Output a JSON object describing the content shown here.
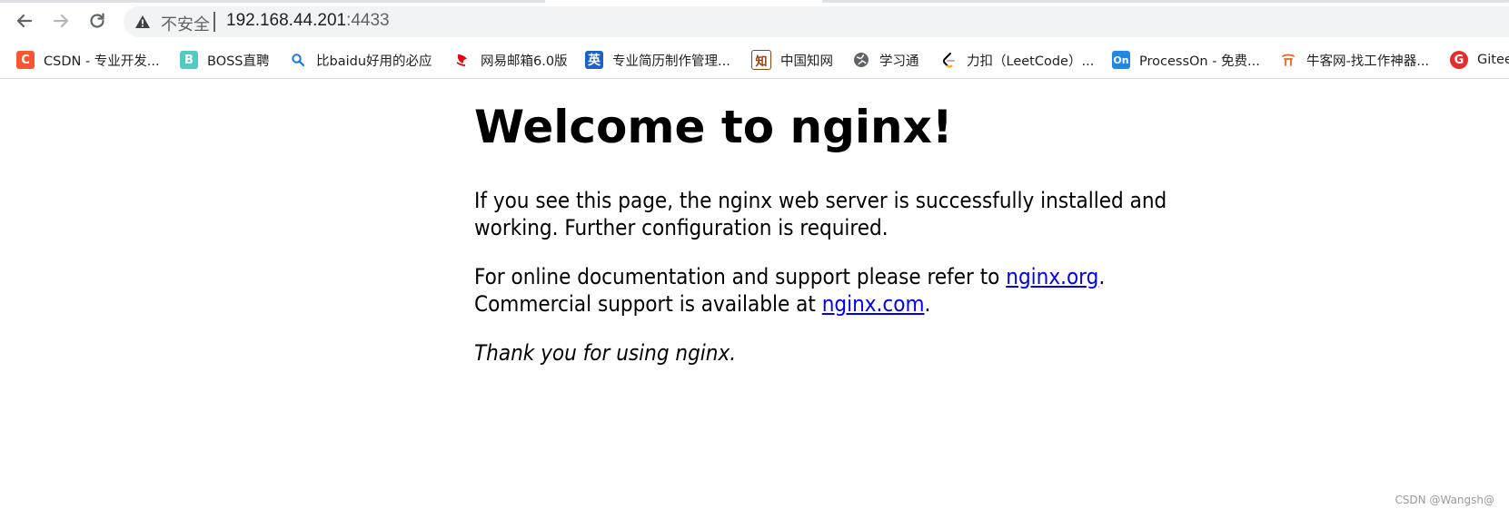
{
  "browser": {
    "omnibox": {
      "security_label": "不安全",
      "url_host": "192.168.44.201",
      "url_port": ":4433"
    },
    "bookmarks": [
      {
        "label": "CSDN - 专业开发...",
        "icon": "csdn-icon",
        "glyph": "C",
        "color": "#fc5531"
      },
      {
        "label": "BOSS直聘",
        "icon": "boss-icon",
        "glyph": "B",
        "color": "#53cac3"
      },
      {
        "label": "比baidu好用的必应",
        "icon": "bing-search-icon",
        "glyph": "",
        "color": "#1a73e8"
      },
      {
        "label": "网易邮箱6.0版",
        "icon": "netease-mail-icon",
        "glyph": "",
        "color": "#e60012"
      },
      {
        "label": "专业简历制作管理...",
        "icon": "resume-icon",
        "glyph": "英",
        "color": "#1e5fc8"
      },
      {
        "label": "中国知网",
        "icon": "cnki-icon",
        "glyph": "知",
        "color": "#8b4513"
      },
      {
        "label": "学习通",
        "icon": "xuexitong-icon",
        "glyph": "",
        "color": "#5f6368"
      },
      {
        "label": "力扣（LeetCode）...",
        "icon": "leetcode-icon",
        "glyph": "",
        "color": "#000000"
      },
      {
        "label": "ProcessOn - 免费...",
        "icon": "processon-icon",
        "glyph": "On",
        "color": "#1e88e5"
      },
      {
        "label": "牛客网-找工作神器...",
        "icon": "nowcoder-icon",
        "glyph": "",
        "color": "#e8632a"
      },
      {
        "label": "Gitee",
        "icon": "gitee-icon",
        "glyph": "G",
        "color": "#e52d2d"
      }
    ]
  },
  "page": {
    "heading": "Welcome to nginx!",
    "p1": "If you see this page, the nginx web server is successfully installed and working. Further configuration is required.",
    "p2_before": "For online documentation and support please refer to ",
    "p2_link": "nginx.org",
    "p2_after": ".",
    "p2_line2_before": "Commercial support is available at ",
    "p2_link2": "nginx.com",
    "p2_line2_after": ".",
    "p3": "Thank you for using nginx."
  },
  "watermark": "CSDN @Wangsh@"
}
